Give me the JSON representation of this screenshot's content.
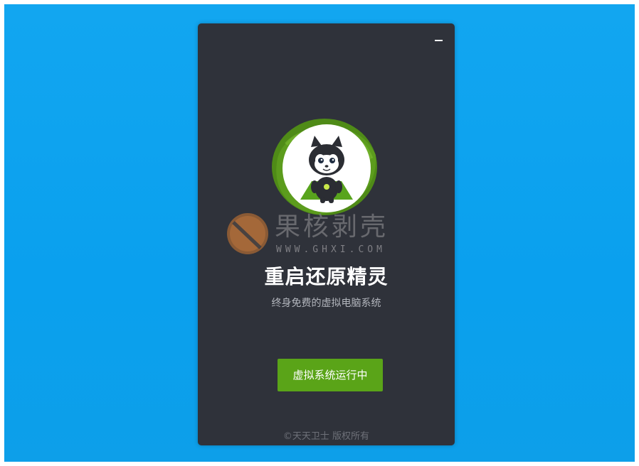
{
  "window": {
    "minimize_label": "−"
  },
  "watermark": {
    "text": "果核剥壳",
    "url": "WWW.GHXI.COM"
  },
  "app": {
    "title": "重启还原精灵",
    "subtitle": "终身免费的虚拟电脑系统",
    "status_button_label": "虚拟系统运行中",
    "copyright": "©天天卫士 版权所有"
  },
  "colors": {
    "desktop": "#0ea3ee",
    "window_bg": "#2f323a",
    "accent_green": "#5aa418",
    "logo_ring_green": "#5a9a1c"
  },
  "icons": {
    "minimize": "minimize-icon",
    "logo": "raccoon-hero-logo",
    "watermark": "nut-icon"
  }
}
